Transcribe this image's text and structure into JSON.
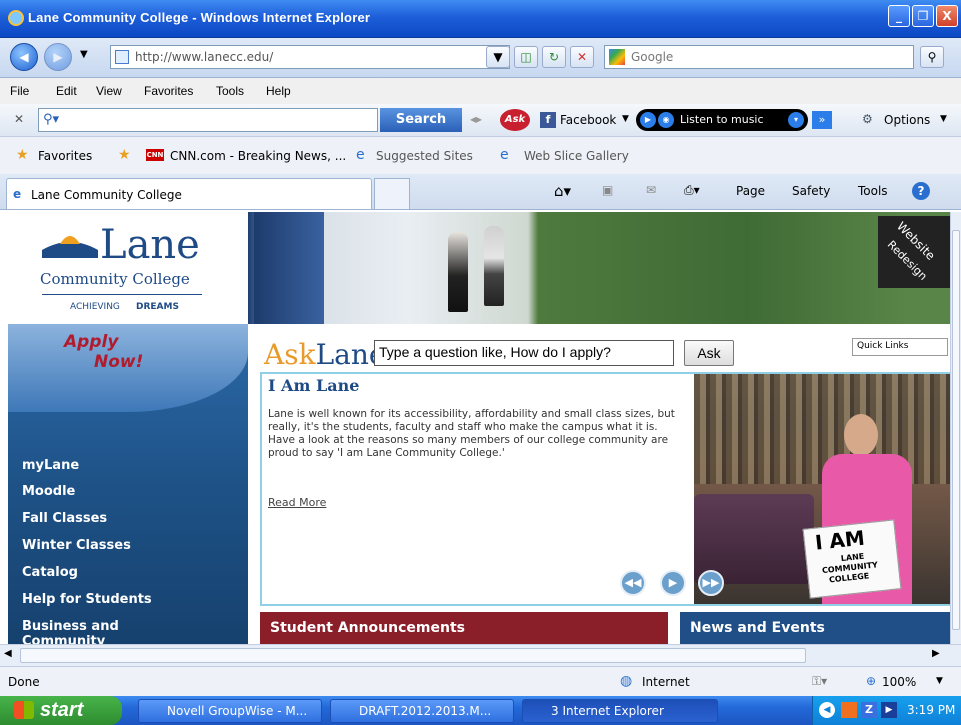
{
  "window": {
    "title": "Lane Community College - Windows Internet Explorer",
    "controls": [
      "_",
      "❐",
      "X"
    ]
  },
  "address_bar": {
    "url": "http://www.lanecc.edu/",
    "search_engine": "Google"
  },
  "menu": [
    "File",
    "Edit",
    "View",
    "Favorites",
    "Tools",
    "Help"
  ],
  "ask_toolbar": {
    "search_label": "Search",
    "facebook_label": "Facebook",
    "music_label": "Listen to music",
    "options_label": "Options"
  },
  "favorites_bar": {
    "favorites_label": "Favorites",
    "items": [
      "CNN.com - Breaking News, ...",
      "Suggested Sites",
      "Web Slice Gallery"
    ]
  },
  "tab": {
    "title": "Lane Community College",
    "commands": [
      "Page",
      "Safety",
      "Tools"
    ]
  },
  "site": {
    "logo_main": "Lane",
    "logo_sub": "Community College",
    "logo_tag_a": "ACHIEVING",
    "logo_tag_b": "DREAMS",
    "redesign_a": "Website",
    "redesign_b": "Redesign",
    "apply_a": "Apply",
    "apply_b": "Now!",
    "nav": [
      "myLane",
      "Moodle",
      "Fall Classes",
      "Winter Classes",
      "Catalog",
      "Help for Students",
      "Business and",
      "Community"
    ],
    "ask_logo_a": "Ask",
    "ask_logo_b": "Lane",
    "ask_placeholder": "Type a question like, How do I apply?",
    "ask_button": "Ask",
    "quick_links": "Quick Links",
    "feature_title": "I Am Lane",
    "feature_body": "Lane is well known for its accessibility, affordability and small class sizes, but really, it's the students, faculty and staff who make the campus what it is. Have a look at the reasons so many members of our college community are proud to say 'I am Lane Community College.'",
    "read_more": "Read More",
    "sign_big": "I AM",
    "sign_small_a": "LANE",
    "sign_small_b": "COMMUNITY",
    "sign_small_c": "COLLEGE",
    "announcements": "Student Announcements",
    "news": "News and Events"
  },
  "status": {
    "text": "Done",
    "zone": "Internet",
    "zoom": "100%"
  },
  "taskbar": {
    "start": "start",
    "tasks": [
      "Novell GroupWise - M...",
      "DRAFT.2012.2013.M...",
      "3 Internet Explorer"
    ],
    "time": "3:19 PM"
  }
}
